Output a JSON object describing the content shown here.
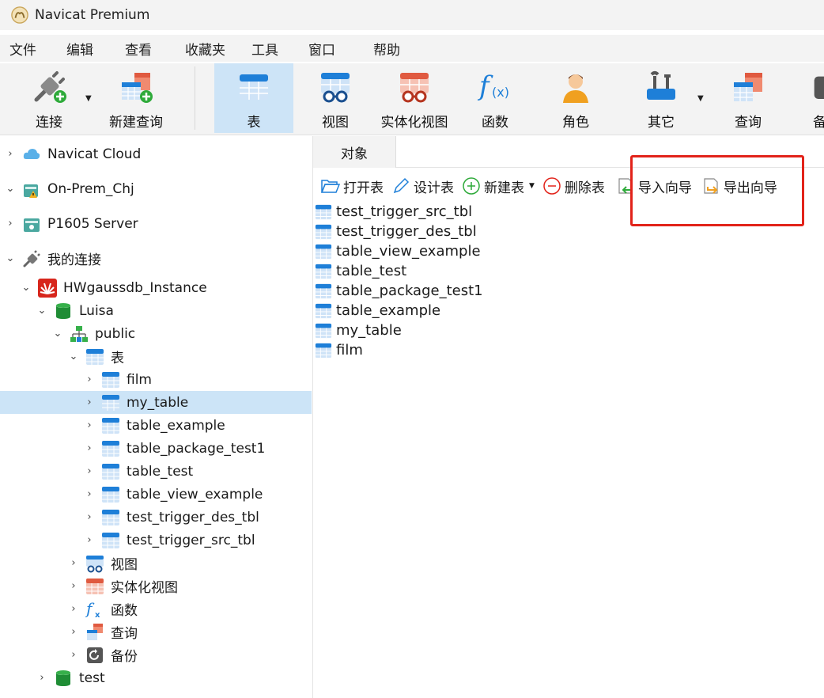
{
  "app": {
    "title": "Navicat Premium"
  },
  "menu": [
    "文件",
    "编辑",
    "查看",
    "收藏夹",
    "工具",
    "窗口",
    "帮助"
  ],
  "toolbar": {
    "connect": "连接",
    "new_query": "新建查询",
    "table": "表",
    "view": "视图",
    "mat_view": "实体化视图",
    "function": "函数",
    "role": "角色",
    "other": "其它",
    "query": "查询",
    "backup": "备"
  },
  "tree": {
    "cloud": "Navicat Cloud",
    "onprem": "On-Prem_Chj",
    "p1605": "P1605 Server",
    "myconn": "我的连接",
    "instance": "HWgaussdb_Instance",
    "db": "Luisa",
    "schema": "public",
    "tables_group": "表",
    "tables": [
      "film",
      "my_table",
      "table_example",
      "table_package_test1",
      "table_test",
      "table_view_example",
      "test_trigger_des_tbl",
      "test_trigger_src_tbl"
    ],
    "views": "视图",
    "mat_views": "实体化视图",
    "functions": "函数",
    "queries": "查询",
    "backups": "备份",
    "db2": "test"
  },
  "main": {
    "tab": "对象",
    "actions": {
      "open": "打开表",
      "design": "设计表",
      "new": "新建表",
      "delete": "删除表",
      "import": "导入向导",
      "export": "导出向导"
    },
    "objects": [
      "test_trigger_src_tbl",
      "test_trigger_des_tbl",
      "table_view_example",
      "table_test",
      "table_package_test1",
      "table_example",
      "my_table",
      "film"
    ]
  },
  "colors": {
    "accent": "#1e7fd8",
    "selection": "#cce4f7",
    "highlight_box": "#e2231a"
  }
}
